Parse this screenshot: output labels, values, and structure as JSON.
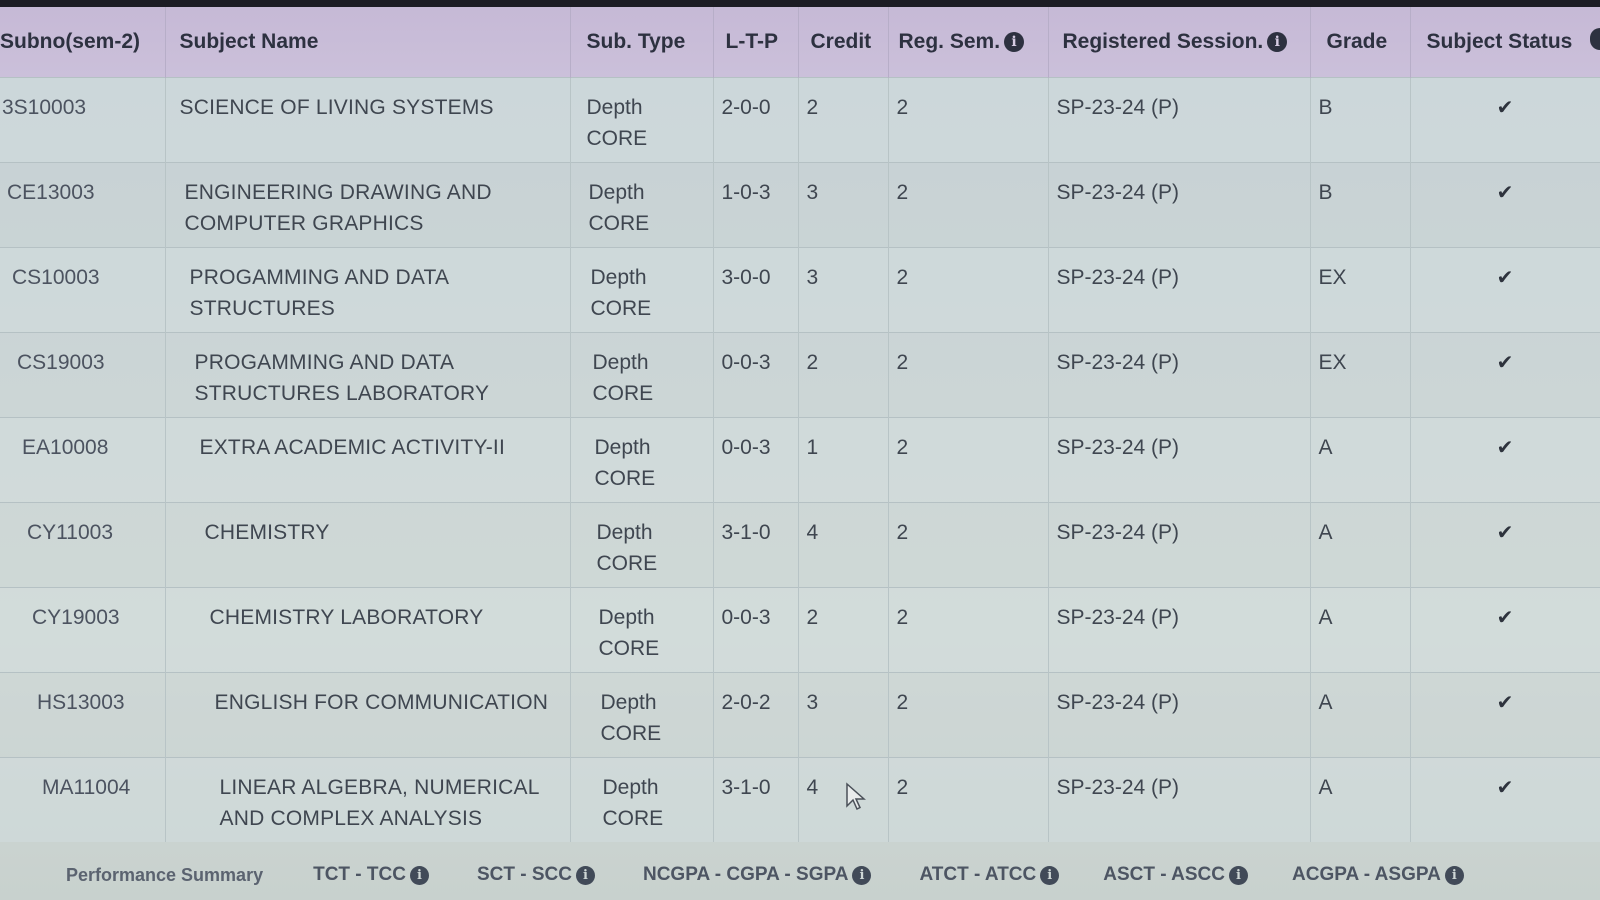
{
  "columns": {
    "subno": "Subno(sem-2)",
    "subject_name": "Subject Name",
    "sub_type": "Sub. Type",
    "ltp": "L-T-P",
    "credit": "Credit",
    "reg_sem": "Reg. Sem.",
    "registered_session": "Registered Session.",
    "grade": "Grade",
    "subject_status": "Subject Status"
  },
  "rows": [
    {
      "code": "3S10003",
      "name": "SCIENCE OF LIVING SYSTEMS",
      "type_line1": "Depth",
      "type_line2": "CORE",
      "ltp": "2-0-0",
      "credit": "2",
      "reg_sem": "2",
      "session": "SP-23-24 (P)",
      "grade": "B",
      "status": "✔"
    },
    {
      "code": "CE13003",
      "name": "ENGINEERING DRAWING AND COMPUTER GRAPHICS",
      "type_line1": "Depth",
      "type_line2": "CORE",
      "ltp": "1-0-3",
      "credit": "3",
      "reg_sem": "2",
      "session": "SP-23-24 (P)",
      "grade": "B",
      "status": "✔"
    },
    {
      "code": "CS10003",
      "name": "PROGAMMING AND DATA STRUCTURES",
      "type_line1": "Depth",
      "type_line2": "CORE",
      "ltp": "3-0-0",
      "credit": "3",
      "reg_sem": "2",
      "session": "SP-23-24 (P)",
      "grade": "EX",
      "status": "✔"
    },
    {
      "code": "CS19003",
      "name": "PROGAMMING AND DATA STRUCTURES LABORATORY",
      "type_line1": "Depth",
      "type_line2": "CORE",
      "ltp": "0-0-3",
      "credit": "2",
      "reg_sem": "2",
      "session": "SP-23-24 (P)",
      "grade": "EX",
      "status": "✔"
    },
    {
      "code": "EA10008",
      "name": "EXTRA ACADEMIC ACTIVITY-II",
      "type_line1": "Depth",
      "type_line2": "CORE",
      "ltp": "0-0-3",
      "credit": "1",
      "reg_sem": "2",
      "session": "SP-23-24 (P)",
      "grade": "A",
      "status": "✔"
    },
    {
      "code": "CY11003",
      "name": "CHEMISTRY",
      "type_line1": "Depth",
      "type_line2": "CORE",
      "ltp": "3-1-0",
      "credit": "4",
      "reg_sem": "2",
      "session": "SP-23-24 (P)",
      "grade": "A",
      "status": "✔"
    },
    {
      "code": "CY19003",
      "name": "CHEMISTRY LABORATORY",
      "type_line1": "Depth",
      "type_line2": "CORE",
      "ltp": "0-0-3",
      "credit": "2",
      "reg_sem": "2",
      "session": "SP-23-24 (P)",
      "grade": "A",
      "status": "✔"
    },
    {
      "code": "HS13003",
      "name": "ENGLISH FOR COMMUNICATION",
      "type_line1": "Depth",
      "type_line2": "CORE",
      "ltp": "2-0-2",
      "credit": "3",
      "reg_sem": "2",
      "session": "SP-23-24 (P)",
      "grade": "A",
      "status": "✔"
    },
    {
      "code": "MA11004",
      "name": "LINEAR ALGEBRA, NUMERICAL AND COMPLEX ANALYSIS",
      "type_line1": "Depth",
      "type_line2": "CORE",
      "ltp": "3-1-0",
      "credit": "4",
      "reg_sem": "2",
      "session": "SP-23-24 (P)",
      "grade": "A",
      "status": "✔"
    }
  ],
  "summary": {
    "performance": "Performance Summary",
    "tct_tcc": "TCT - TCC",
    "sct_scc": "SCT - SCC",
    "ncgpa": "NCGPA - CGPA - SGPA",
    "atct_atcc": "ATCT - ATCC",
    "asct_ascc": "ASCT - ASCC",
    "acgpa_asgpa": "ACGPA - ASGPA"
  },
  "icons": {
    "info": "i",
    "check": "checkmark-icon",
    "cursor": "mouse-pointer-icon"
  },
  "colors": {
    "header_bg": "#c9bdd8",
    "table_bg": "#cdd6d6",
    "text": "#3f4650"
  }
}
